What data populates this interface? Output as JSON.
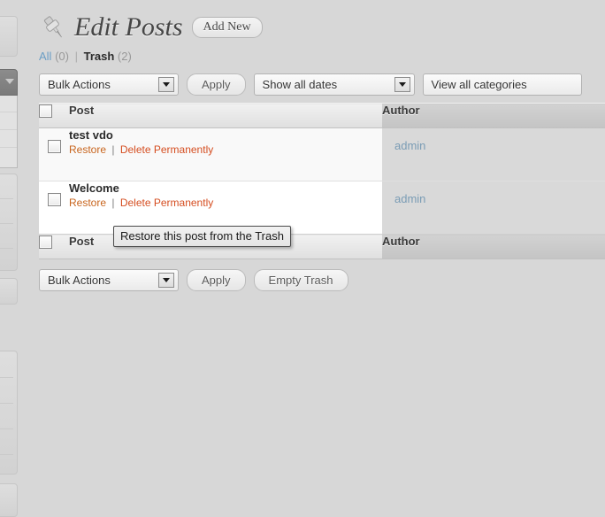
{
  "sidebar": {
    "items": [
      {
        "name": "menu-item-1",
        "state": "normal"
      },
      {
        "name": "menu-item-posts",
        "state": "current"
      },
      {
        "name": "menu-item-3",
        "state": "normal"
      },
      {
        "name": "menu-item-4",
        "state": "normal"
      },
      {
        "name": "menu-item-5",
        "state": "normal"
      },
      {
        "name": "menu-item-6",
        "state": "normal"
      },
      {
        "name": "menu-item-7",
        "state": "normal"
      }
    ]
  },
  "header": {
    "icon": "pushpin-icon",
    "title": "Edit Posts",
    "add_new_label": "Add New"
  },
  "views": {
    "all_label": "All",
    "all_count": "(0)",
    "divider": "|",
    "trash_label": "Trash",
    "trash_count": "(2)"
  },
  "tablenav_top": {
    "bulk_actions_label": "Bulk Actions",
    "apply_label": "Apply",
    "dates_label": "Show all dates",
    "categories_label": "View all categories"
  },
  "table": {
    "columns": {
      "post": "Post",
      "author": "Author"
    },
    "rows": [
      {
        "title": "test vdo",
        "author": "admin",
        "actions": {
          "restore": "Restore",
          "separator": "|",
          "delete": "Delete Permanently"
        }
      },
      {
        "title": "Welcome",
        "author": "admin",
        "actions": {
          "restore": "Restore",
          "separator": "|",
          "delete": "Delete Permanently"
        }
      }
    ]
  },
  "tooltip": {
    "text": "Restore this post from the Trash"
  },
  "tablenav_bottom": {
    "bulk_actions_label": "Bulk Actions",
    "apply_label": "Apply",
    "empty_trash_label": "Empty Trash"
  },
  "colors": {
    "page_background": "#d7d7d7",
    "link_blue": "#6a9ec5",
    "restore_orange": "#c8651e",
    "delete_red": "#d54e21",
    "author_link": "#7a9cb5",
    "title_text": "#464646"
  }
}
